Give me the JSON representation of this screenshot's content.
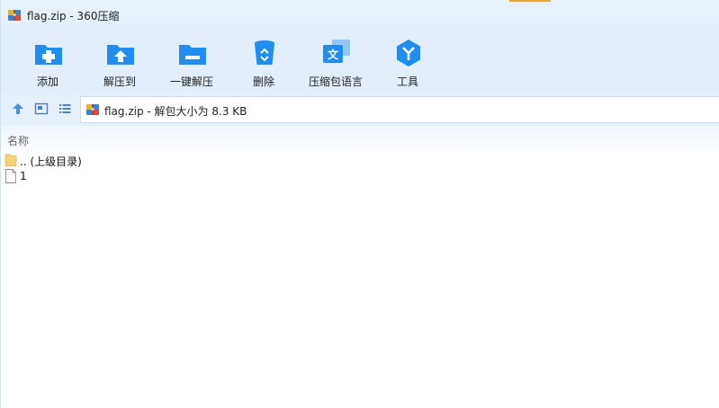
{
  "window": {
    "title": "flag.zip - 360压缩",
    "accent_color": "#e3a53d"
  },
  "toolbar": {
    "icon_color": "#1e8ef0",
    "items": [
      {
        "label": "添加",
        "icon": "add-folder-icon"
      },
      {
        "label": "解压到",
        "icon": "extract-to-icon"
      },
      {
        "label": "一键解压",
        "icon": "one-click-extract-icon"
      },
      {
        "label": "删除",
        "icon": "delete-icon"
      },
      {
        "label": "压缩包语言",
        "icon": "language-icon"
      },
      {
        "label": "工具",
        "icon": "tools-icon"
      }
    ]
  },
  "pathbar": {
    "nav": [
      {
        "icon": "up-arrow-icon"
      },
      {
        "icon": "thumbnail-view-icon"
      },
      {
        "icon": "list-view-icon"
      }
    ],
    "path_text": "flag.zip - 解包大小为 8.3 KB"
  },
  "columns": {
    "name": "名称"
  },
  "files": [
    {
      "name": ".. (上级目录)",
      "icon": "folder-icon"
    },
    {
      "name": "1",
      "icon": "file-icon"
    }
  ]
}
